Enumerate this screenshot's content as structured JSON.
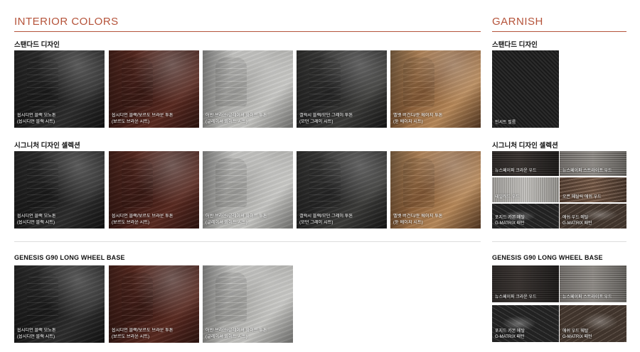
{
  "colors": {
    "accent": "#b5533a"
  },
  "interior": {
    "title": "INTERIOR COLORS",
    "standard": {
      "heading": "스탠다드 디자인",
      "tiles": [
        {
          "line1": "옵시디언 블랙 모노톤",
          "line2": "(옵시디언 블랙 시트)",
          "tone": "black"
        },
        {
          "line1": "옵시디언 블랙/보르도 브라운 투톤",
          "line2": "(보르도 브라운 시트)",
          "tone": "brown"
        },
        {
          "line1": "어반 브라운/글레이셔 화이트 투톤",
          "line2": "(글레이셔 화이트 시트)",
          "tone": "white"
        },
        {
          "line1": "갤럭시 블랙/모던 그레이 투톤",
          "line2": "(모던 그레이 시트)",
          "tone": "gray"
        },
        {
          "line1": "벨벳 버건디/듄 베이지 투톤",
          "line2": "(듄 베이지 시트)",
          "tone": "beige"
        }
      ]
    },
    "signature": {
      "heading": "시그니처 디자인 셀렉션",
      "tiles": [
        {
          "line1": "옵시디언 블랙 모노톤",
          "line2": "(옵시디언 블랙 시트)",
          "tone": "black"
        },
        {
          "line1": "옵시디언 블랙/보르도 브라운 투톤",
          "line2": "(보르도 브라운 시트)",
          "tone": "brown"
        },
        {
          "line1": "어반 브라운/글레이셔 화이트 투톤",
          "line2": "(글레이셔 화이트 시트)",
          "tone": "white"
        },
        {
          "line1": "갤럭시 블랙/모던 그레이 투톤",
          "line2": "(모던 그레이 시트)",
          "tone": "gray"
        },
        {
          "line1": "벨벳 버건디/듄 베이지 투톤",
          "line2": "(듄 베이지 시트)",
          "tone": "beige"
        }
      ]
    },
    "lwb": {
      "heading": "GENESIS G90 LONG WHEEL BASE",
      "tiles": [
        {
          "line1": "옵시디언 블랙 모노톤",
          "line2": "(옵시디언 블랙 시트)",
          "tone": "black"
        },
        {
          "line1": "옵시디언 블랙/보르도 브라운 투톤",
          "line2": "(보르도 브라운 시트)",
          "tone": "brown"
        },
        {
          "line1": "어반 브라운/글레이셔 화이트 투톤",
          "line2": "(글레이셔 화이트 시트)",
          "tone": "white"
        }
      ]
    }
  },
  "garnish": {
    "title": "GARNISH",
    "standard": {
      "heading": "스탠다드 디자인",
      "tiles": [
        {
          "line1": "인서트 필름",
          "line2": ""
        }
      ]
    },
    "signature": {
      "heading": "시그니처 디자인 셀렉션",
      "tiles": [
        {
          "line1": "뉴스페이퍼 크라운 우드",
          "line2": ""
        },
        {
          "line1": "뉴스페이퍼 스트라이프 우드",
          "line2": ""
        },
        {
          "line1": "테일러드 우드",
          "line2": ""
        },
        {
          "line1": "오픈 메탈릭 애쉬 우드",
          "line2": ""
        },
        {
          "line1": "포지드 카본 메탈",
          "line2": "G-MATRIX 패턴"
        },
        {
          "line1": "애쉬 우드 메탈",
          "line2": "G-MATRIX 패턴"
        }
      ]
    },
    "lwb": {
      "heading": "GENESIS G90 LONG WHEEL BASE",
      "tiles": [
        {
          "line1": "뉴스페이퍼 크라운 우드",
          "line2": ""
        },
        {
          "line1": "뉴스페이퍼 스트라이프 우드",
          "line2": ""
        },
        {
          "line1": "포지드 카본 메탈",
          "line2": "G-MATRIX 패턴"
        },
        {
          "line1": "애쉬 우드 메탈",
          "line2": "G-MATRIX 패턴"
        }
      ]
    }
  }
}
